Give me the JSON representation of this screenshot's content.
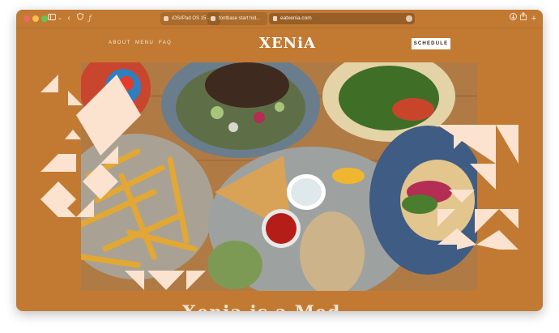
{
  "browser": {
    "tabs": [
      {
        "label": "iOS/iPad OS 15 -..."
      },
      {
        "label": "fontbase start hid..."
      }
    ],
    "url": "eatxenia.com",
    "icons": [
      "sidebar-icon",
      "chevron-down-icon",
      "back-icon",
      "shield-icon",
      "script-icon",
      "download-icon",
      "share-icon",
      "new-tab-icon"
    ]
  },
  "site": {
    "nav": {
      "about": "ABOUT",
      "menu": "MENU",
      "faq": "FAQ"
    },
    "logo": "XENiA",
    "schedule": "SCHEDULE",
    "heading": "Xenia is a Med",
    "colors": {
      "background": "#c27a33",
      "accent": "#fbe3cf",
      "logo": "#ffffff"
    }
  }
}
